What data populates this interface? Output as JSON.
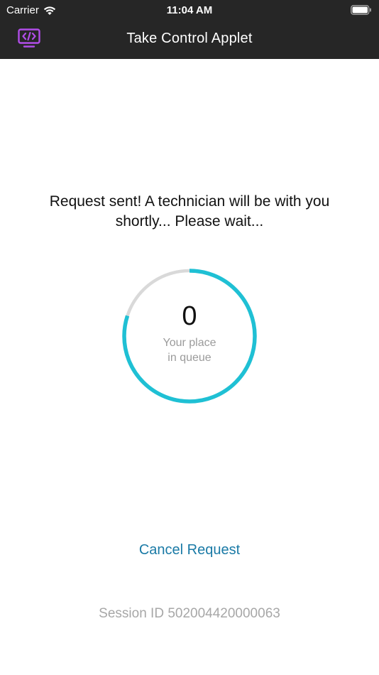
{
  "status_bar": {
    "carrier": "Carrier",
    "time": "11:04 AM",
    "wifi_icon": "wifi-icon",
    "battery_icon": "battery-icon"
  },
  "nav": {
    "title": "Take Control Applet",
    "app_icon": "code-monitor-icon",
    "accent_color": "#b14de8"
  },
  "main": {
    "message_line1": "Request sent! A technician will be with you",
    "message_line2": "shortly... Please wait...",
    "queue": {
      "count": "0",
      "label_line1": "Your place",
      "label_line2": "in queue",
      "progress_fraction": 0.8,
      "progress_color": "#1fc0d4",
      "track_color": "#d9d9d9"
    },
    "cancel_label": "Cancel Request",
    "session_id": "Session ID 502004420000063"
  },
  "colors": {
    "header_bg": "#262626",
    "link": "#1a7aa6"
  }
}
